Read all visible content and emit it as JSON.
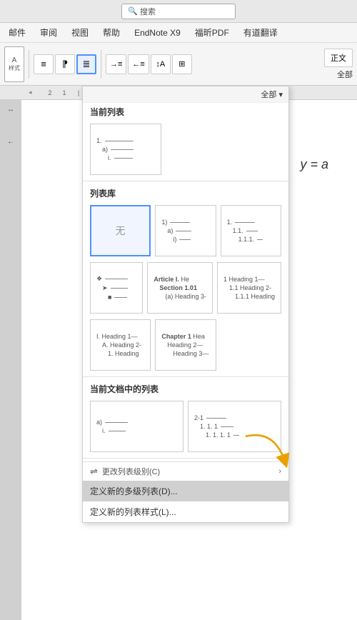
{
  "titlebar": {
    "search_placeholder": "搜索"
  },
  "menubar": {
    "items": [
      "邮件",
      "审阅",
      "视图",
      "帮助",
      "EndNote X9",
      "福昕PDF",
      "有道翻译"
    ]
  },
  "ribbon": {
    "style_label": "正文",
    "filter_label": "全部",
    "buttons": [
      "list-bullet",
      "list-number",
      "multilevel-list",
      "indent-left",
      "indent-right",
      "sort",
      "border"
    ]
  },
  "dropdown": {
    "filter": "全部 ▾",
    "sections": {
      "current_list": "当前列表",
      "list_library": "列表库",
      "doc_lists": "当前文档中的列表"
    },
    "current_list": {
      "preview_lines": [
        "1. ———",
        "a) ———",
        "i. ———"
      ]
    },
    "library": {
      "item0_label": "无",
      "item1_lines": [
        "1)",
        "a)",
        "i)"
      ],
      "item2_lines": [
        "1.",
        "1.1.",
        "1.1.1."
      ],
      "item3_lines": [
        "❖ ——",
        "➤ ——",
        "■ ——"
      ],
      "item4_lines": [
        "Article I. He",
        "Section 1.01",
        "(a) Heading 3-"
      ],
      "item5_lines": [
        "1 Heading 1—",
        "1.1 Heading 2-",
        "1.1.1 Heading"
      ],
      "item6_lines": [
        "I. Heading 1—",
        "A. Heading 2-",
        "1. Heading"
      ],
      "item7_lines": [
        "Chapter 1 Hea",
        "Heading 2—",
        "Heading 3—"
      ]
    },
    "doc_lists": {
      "item0_lines": [
        "a) ———",
        "i. ———"
      ],
      "item1_lines": [
        "2-1 ———",
        "1. 1. 1 ———",
        "1. 1. 1. 1 —"
      ]
    },
    "actions": {
      "change_level": "更改列表级别(C)",
      "define_multilevel": "定义新的多级列表(D)...",
      "define_style": "定义新的列表样式(L)..."
    }
  },
  "doc": {
    "math_formula": "y = a"
  },
  "icons": {
    "search": "🔍",
    "list_bullet": "≡",
    "list_num": "⁋",
    "multilevel": "≣",
    "indent_left": "←",
    "indent_right": "→",
    "sort": "↕",
    "border": "⊞",
    "change_level": "⇌",
    "chevron_right": "›",
    "arrow": "→"
  }
}
